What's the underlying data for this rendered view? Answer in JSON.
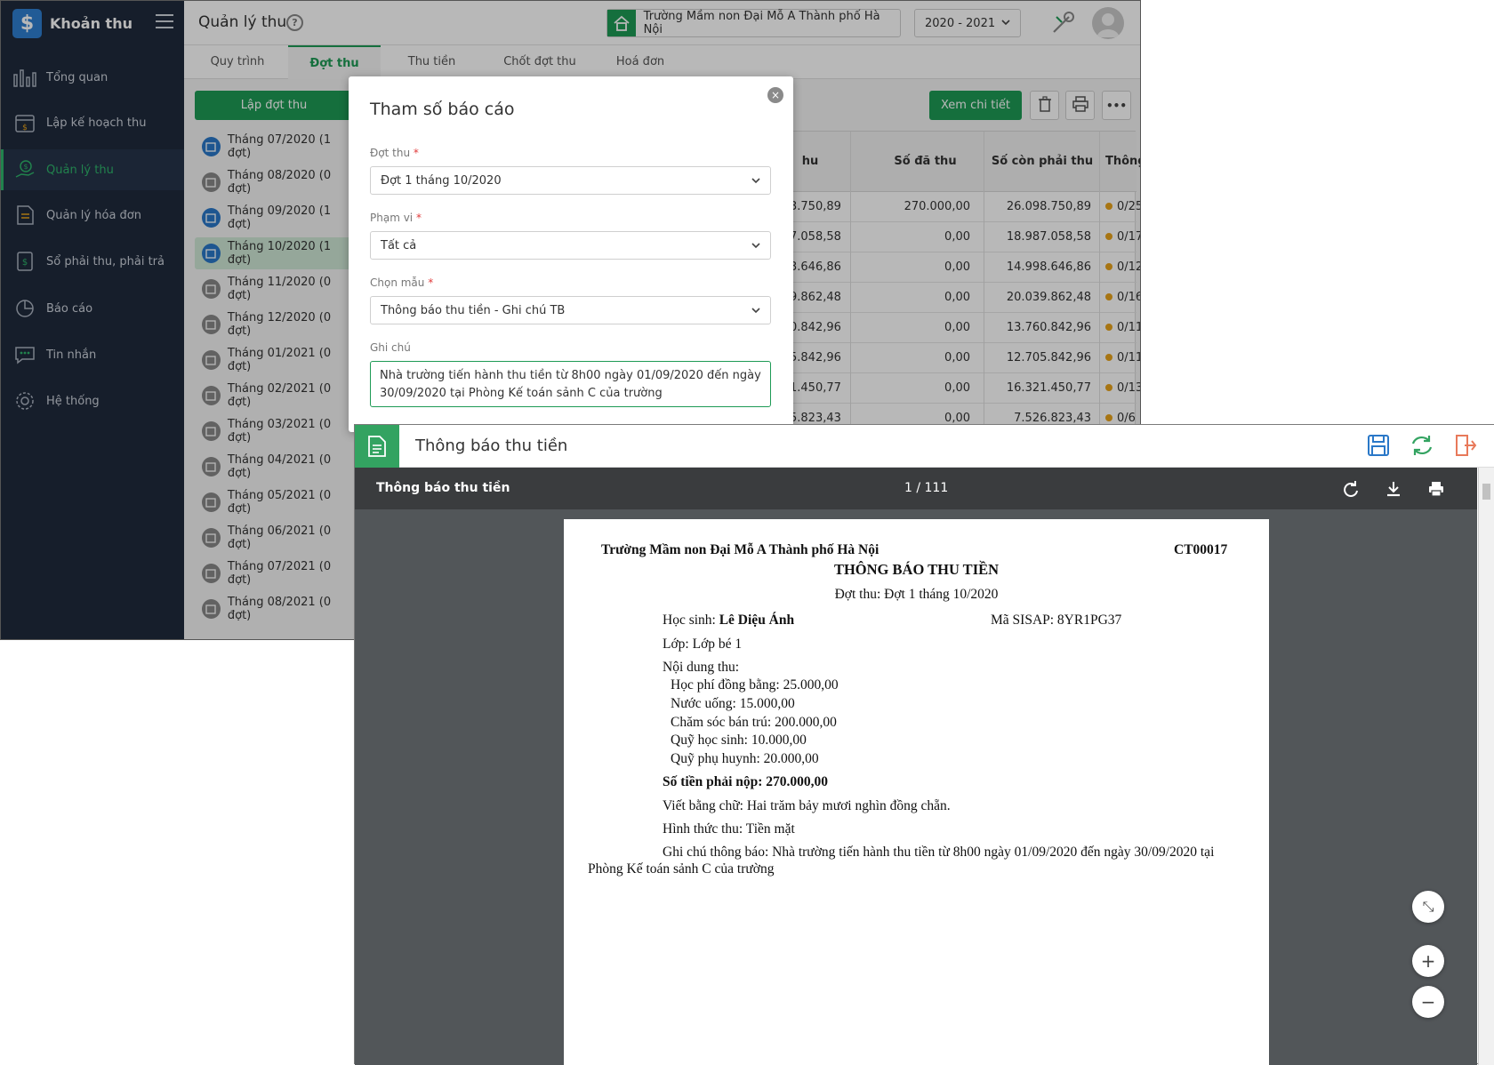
{
  "app": {
    "name": "Khoản thu",
    "logo_symbol": "$"
  },
  "sidebar": {
    "items": [
      {
        "label": "Tổng quan",
        "icon": "bar-chart-icon"
      },
      {
        "label": "Lập kế hoạch thu",
        "icon": "calendar-money-icon"
      },
      {
        "label": "Quản lý thu",
        "icon": "hand-money-icon",
        "active": true
      },
      {
        "label": "Quản lý hóa đơn",
        "icon": "invoice-icon"
      },
      {
        "label": "Sổ phải thu, phải trả",
        "icon": "ledger-icon"
      },
      {
        "label": "Báo cáo",
        "icon": "pie-chart-icon"
      },
      {
        "label": "Tin nhắn",
        "icon": "message-icon"
      },
      {
        "label": "Hệ thống",
        "icon": "gear-icon"
      }
    ]
  },
  "header": {
    "title": "Quản lý thu",
    "help": "?",
    "school": "Trường Mầm non Đại Mỗ A Thành phố Hà Nội",
    "year": "2020 - 2021"
  },
  "tabs": [
    "Quy trình",
    "Đợt thu",
    "Thu tiền",
    "Chốt đợt thu",
    "Hoá đơn"
  ],
  "left_panel": {
    "create_button": "Lập đợt thu",
    "periods": [
      "Tháng 07/2020 (1 đợt)",
      "Tháng 08/2020 (0 đợt)",
      "Tháng 09/2020 (1 đợt)",
      "Tháng 10/2020 (1 đợt)",
      "Tháng 11/2020 (0 đợt)",
      "Tháng 12/2020 (0 đợt)",
      "Tháng 01/2021 (0 đợt)",
      "Tháng 02/2021 (0 đợt)",
      "Tháng 03/2021 (0 đợt)",
      "Tháng 04/2021 (0 đợt)",
      "Tháng 05/2021 (0 đợt)",
      "Tháng 06/2021 (0 đợt)",
      "Tháng 07/2021 (0 đợt)",
      "Tháng 08/2021 (0 đợt)"
    ]
  },
  "toolbar": {
    "detail_button": "Xem chi tiết",
    "more": "•••"
  },
  "table": {
    "columns": [
      "hu",
      "Số đã thu",
      "Số còn phải thu",
      "Thông"
    ],
    "rows": [
      [
        "3.750,89",
        "270.000,00",
        "26.098.750,89",
        "0/25"
      ],
      [
        "7.058,58",
        "0,00",
        "18.987.058,58",
        "0/17"
      ],
      [
        "3.646,86",
        "0,00",
        "14.998.646,86",
        "0/12"
      ],
      [
        "9.862,48",
        "0,00",
        "20.039.862,48",
        "0/16"
      ],
      [
        "0.842,96",
        "0,00",
        "13.760.842,96",
        "0/11"
      ],
      [
        "5.842,96",
        "0,00",
        "12.705.842,96",
        "0/11"
      ],
      [
        "1.450,77",
        "0,00",
        "16.321.450,77",
        "0/13"
      ],
      [
        "5.823,43",
        "0,00",
        "7.526.823,43",
        "0/6"
      ]
    ]
  },
  "modal": {
    "title": "Tham số báo cáo",
    "close": "×",
    "fields": {
      "dot_thu": {
        "label": "Đợt thu",
        "required": "*",
        "value": "Đợt 1 tháng 10/2020"
      },
      "pham_vi": {
        "label": "Phạm vi",
        "required": "*",
        "value": "Tất cả"
      },
      "chon_mau": {
        "label": "Chọn mẫu",
        "required": "*",
        "value": "Thông báo thu tiền - Ghi chú TB"
      },
      "ghi_chu": {
        "label": "Ghi chú",
        "line1": "Nhà trường tiến hành thu tiền từ 8h00 ngày 01/09/2020 đến ngày",
        "line2": "30/09/2020 tại Phòng Kế toán sảnh C của trường"
      }
    }
  },
  "viewer": {
    "title": "Thông báo thu tiền",
    "pdf_name": "Thông báo thu tiền",
    "page": "1 / 111"
  },
  "document": {
    "school": "Trường Mầm non Đại Mỗ A Thành phố Hà Nội",
    "code": "CT00017",
    "title": "THÔNG BÁO THU TIỀN",
    "period": "Đợt thu: Đợt 1 tháng 10/2020",
    "student_label": "Học sinh: ",
    "student_name": "Lê Diệu Ánh",
    "sisap": "Mã SISAP: 8YR1PG37",
    "class": "Lớp:  Lớp bé 1",
    "content_label": "Nội dung thu:",
    "items": [
      "Học phí đồng bằng: 25.000,00",
      "Nước uống: 15.000,00",
      "Chăm sóc bán trú: 200.000,00",
      "Quỹ học sinh: 10.000,00",
      "Quỹ phụ huynh: 20.000,00"
    ],
    "total": "Số tiền phải nộp: 270.000,00",
    "in_words": "Viết bằng chữ: Hai trăm bảy mươi nghìn đồng chẵn.",
    "method": "Hình thức thu: Tiền mặt",
    "note_line1": "Ghi chú thông báo: Nhà trường tiến hành thu tiền từ 8h00 ngày 01/09/2020 đến ngày 30/09/2020 tại",
    "note_line2": "Phòng Kế toán sảnh C của trường"
  },
  "zoom": {
    "fit": "⤡",
    "in": "+",
    "out": "−"
  },
  "colors": {
    "brand_green": "#1e9a55",
    "sidebar_bg": "#1f2a3c",
    "accent_blue": "#2a78c8",
    "status_dot": "#e8a21b"
  }
}
